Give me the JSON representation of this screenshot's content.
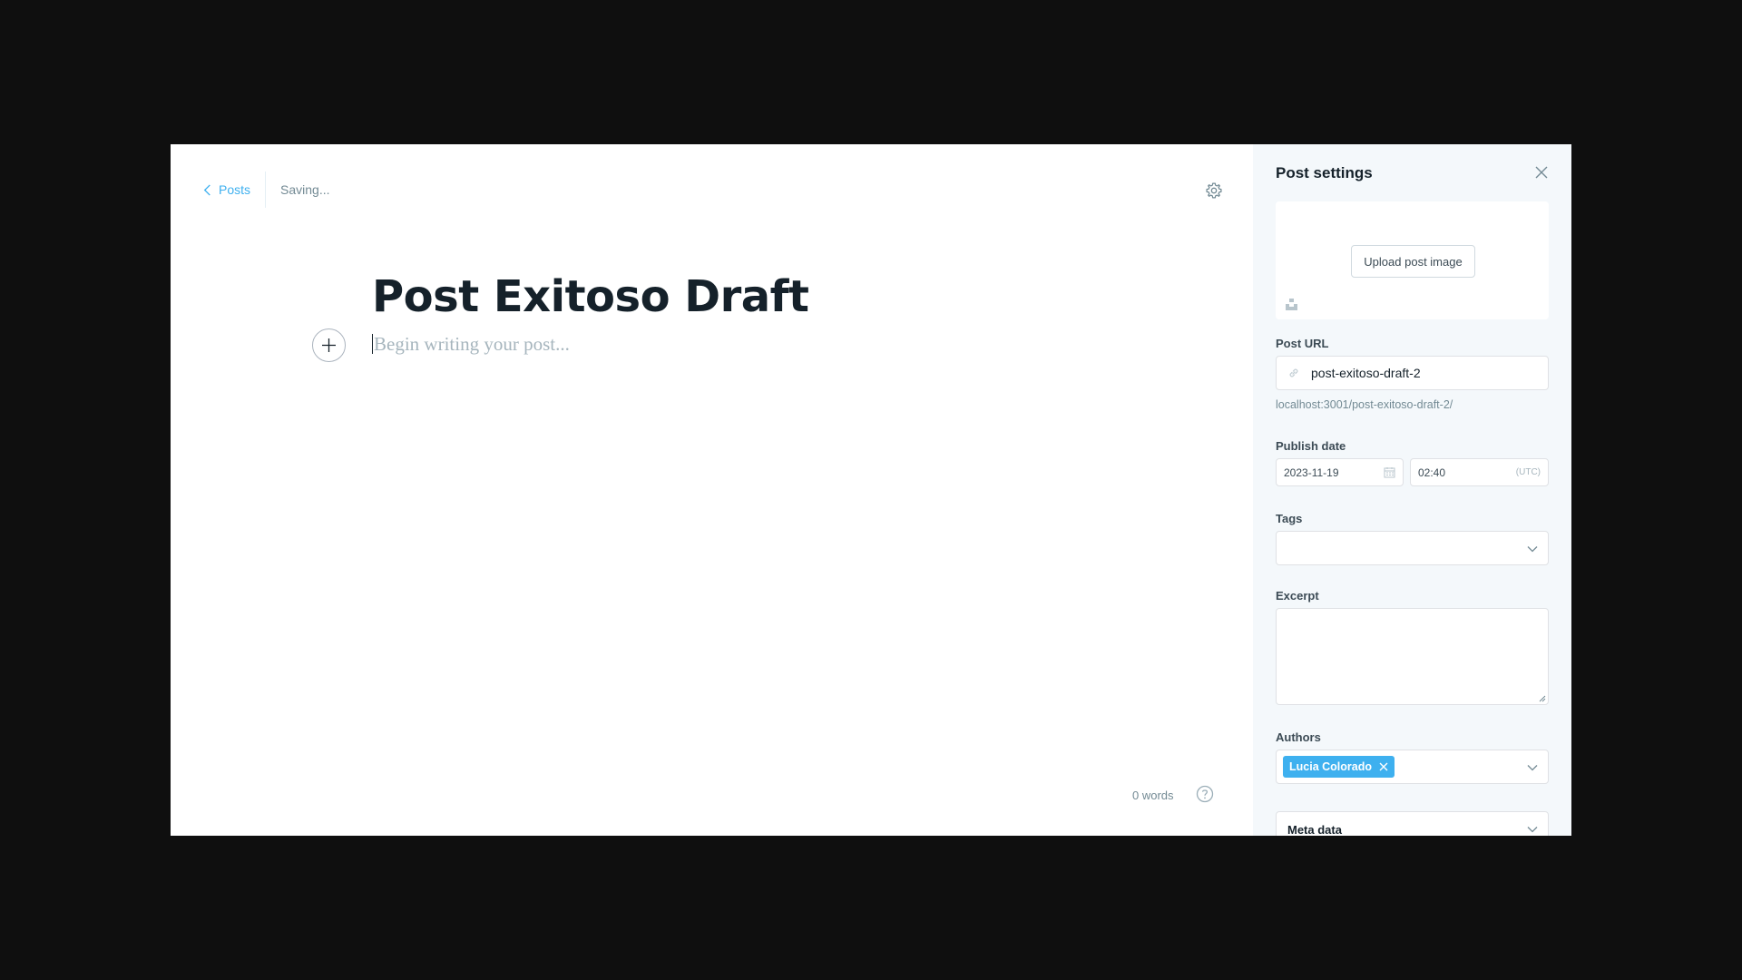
{
  "editor": {
    "back_label": "Posts",
    "save_status": "Saving...",
    "title": "Post Exitoso Draft",
    "body_placeholder": "Begin writing your post...",
    "word_count": "0 words"
  },
  "settings": {
    "title": "Post settings",
    "upload_button": "Upload post image",
    "post_url_label": "Post URL",
    "post_url_value": "post-exitoso-draft-2",
    "post_url_preview": "localhost:3001/post-exitoso-draft-2/",
    "publish_date_label": "Publish date",
    "publish_date": "2023-11-19",
    "publish_time": "02:40",
    "timezone": "(UTC)",
    "tags_label": "Tags",
    "excerpt_label": "Excerpt",
    "authors_label": "Authors",
    "authors": [
      "Lucia Colorado"
    ],
    "meta_label": "Meta data"
  },
  "colors": {
    "accent": "#3eb0ef",
    "text": "#15212a",
    "muted": "#738a94",
    "panel_bg": "#f4f8fb",
    "backdrop": "#0f0f0f"
  },
  "icons": [
    "chevron-left-icon",
    "gear-icon",
    "plus-icon",
    "help-icon",
    "close-icon",
    "unsplash-icon",
    "link-icon",
    "calendar-icon",
    "chevron-down-icon",
    "remove-author-icon"
  ]
}
